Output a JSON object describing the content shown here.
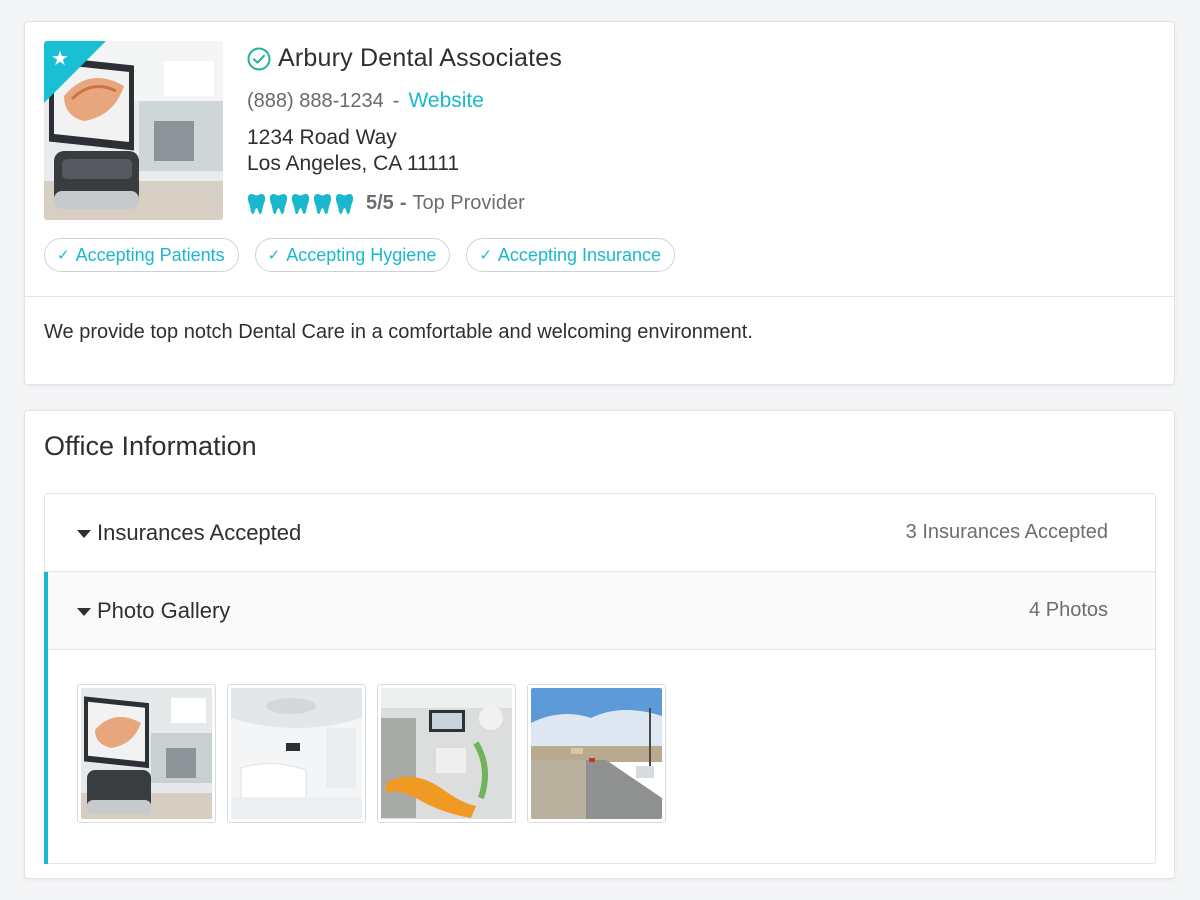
{
  "profile": {
    "name": "Arbury Dental Associates",
    "phone": "(888) 888-1234",
    "separator": "-",
    "website_label": "Website",
    "address_line1": "1234 Road Way",
    "address_line2": "Los Angeles, CA 11111",
    "rating": {
      "score": "5/5",
      "dash": "-",
      "label": "Top Provider",
      "value": 5,
      "max": 5,
      "icon": "tooth-icon"
    },
    "badges": [
      {
        "label": "Accepting Patients",
        "icon": "check-icon"
      },
      {
        "label": "Accepting Hygiene",
        "icon": "check-icon"
      },
      {
        "label": "Accepting Insurance",
        "icon": "check-icon"
      }
    ],
    "description": "We provide top notch Dental Care in a comfortable and welcoming environment.",
    "featured_icon": "star-icon",
    "verified_icon": "verified-check-icon"
  },
  "office": {
    "title": "Office Information",
    "sections": [
      {
        "label": "Insurances Accepted",
        "summary": "3 Insurances Accepted",
        "expanded": false
      },
      {
        "label": "Photo Gallery",
        "summary": "4 Photos",
        "expanded": true
      }
    ],
    "gallery": [
      "dental-scanner-photo",
      "white-clinic-room-photo",
      "orange-dental-chair-photo",
      "street-view-photo"
    ]
  },
  "colors": {
    "accent": "#19b8cf",
    "text": "#2d2f31",
    "muted": "#6a6e72",
    "verified": "#1fb39a",
    "border": "#e2e4e6"
  }
}
